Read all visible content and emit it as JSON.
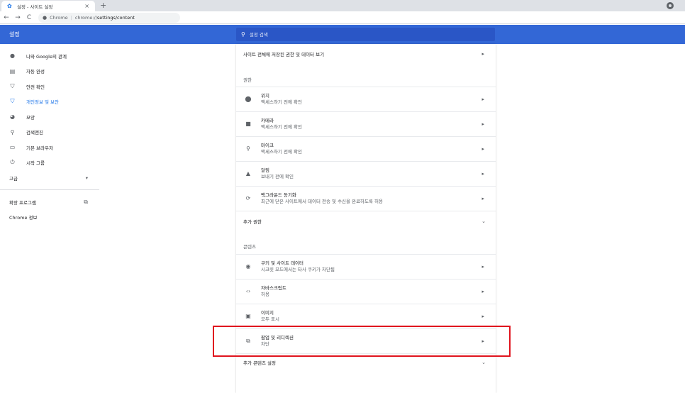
{
  "tab": {
    "title": "설정 - 사이트 설정",
    "close": "×",
    "new_tab": "+"
  },
  "toolbar": {
    "back": "←",
    "forward": "→",
    "reload": "C",
    "site": "Chrome",
    "sep": "|",
    "url_prefix": "chrome://",
    "url_bold": "settings/content"
  },
  "header": {
    "title": "설정",
    "search_placeholder": "설정 검색"
  },
  "sidebar": {
    "items": [
      {
        "label": "나와 Google의 관계",
        "icon": "person-icon"
      },
      {
        "label": "자동 완성",
        "icon": "clipboard-icon"
      },
      {
        "label": "안전 확인",
        "icon": "shield-check-icon"
      },
      {
        "label": "개인정보 및 보안",
        "icon": "shield-icon"
      },
      {
        "label": "모양",
        "icon": "palette-icon"
      },
      {
        "label": "검색엔진",
        "icon": "search-icon"
      },
      {
        "label": "기본 브라우저",
        "icon": "browser-icon"
      },
      {
        "label": "시작 그룹",
        "icon": "power-icon"
      }
    ],
    "advanced": "고급",
    "extensions": "확장 프로그램",
    "about": "Chrome 정보"
  },
  "main": {
    "view_all": "사이트 전체에 저장된 권한 및 데이터 보기",
    "permissions_title": "권한",
    "permissions": [
      {
        "title": "위치",
        "sub": "액세스하기 전에 확인",
        "icon": "location-icon"
      },
      {
        "title": "카메라",
        "sub": "액세스하기 전에 확인",
        "icon": "camera-icon"
      },
      {
        "title": "마이크",
        "sub": "액세스하기 전에 확인",
        "icon": "mic-icon"
      },
      {
        "title": "알림",
        "sub": "보내기 전에 확인",
        "icon": "bell-icon"
      },
      {
        "title": "백그라운드 동기화",
        "sub": "최근에 닫은 사이트에서 데이터 전송 및 수신을 완료하도록 허용",
        "icon": "sync-icon"
      }
    ],
    "more_permissions": "추가 권한",
    "content_title": "콘텐츠",
    "content": [
      {
        "title": "쿠키 및 사이트 데이터",
        "sub": "시크릿 모드에서는 타사 쿠키가 차단됨",
        "icon": "cookie-icon"
      },
      {
        "title": "자바스크립트",
        "sub": "허용",
        "icon": "code-icon"
      },
      {
        "title": "이미지",
        "sub": "모두 표시",
        "icon": "image-icon"
      },
      {
        "title": "팝업 및 리디렉션",
        "sub": "차단",
        "icon": "popup-icon"
      }
    ],
    "more_content": "추가 콘텐츠 설정"
  },
  "colors": {
    "header": "#3367d6",
    "active": "#1a73e8",
    "highlight": "#e0141e"
  }
}
